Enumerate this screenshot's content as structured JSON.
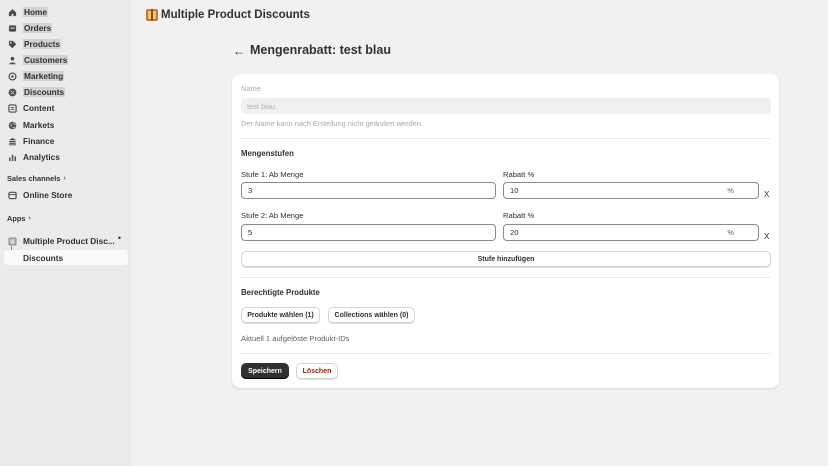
{
  "sidebar": {
    "items": [
      {
        "label": "Home",
        "icon": "home-icon"
      },
      {
        "label": "Orders",
        "icon": "orders-icon"
      },
      {
        "label": "Products",
        "icon": "tag-icon"
      },
      {
        "label": "Customers",
        "icon": "person-icon"
      },
      {
        "label": "Marketing",
        "icon": "target-icon"
      },
      {
        "label": "Discounts",
        "icon": "discount-icon"
      },
      {
        "label": "Content",
        "icon": "content-icon"
      },
      {
        "label": "Markets",
        "icon": "globe-icon"
      },
      {
        "label": "Finance",
        "icon": "bank-icon"
      },
      {
        "label": "Analytics",
        "icon": "bar-chart-icon"
      }
    ],
    "sales_channels_label": "Sales channels",
    "online_store_label": "Online Store",
    "apps_label": "Apps",
    "app_label": "Multiple Product Disc...",
    "app_subitem_label": "Discounts"
  },
  "header": {
    "app_title": "Multiple Product Discounts"
  },
  "page": {
    "back_arrow": "←",
    "title": "Mengenrabatt: test blau"
  },
  "form": {
    "name_label": "Name",
    "name_value": "test blau",
    "name_help": "Der Name kann nach Erstellung nicht geändert werden.",
    "tiers_heading": "Mengenstufen",
    "tiers": [
      {
        "qty_label": "Stufe 1: Ab Menge",
        "qty_value": "3",
        "discount_label": "Rabatt %",
        "discount_value": "10",
        "suffix": "%",
        "remove": "X"
      },
      {
        "qty_label": "Stufe 2: Ab Menge",
        "qty_value": "5",
        "discount_label": "Rabatt %",
        "discount_value": "20",
        "suffix": "%",
        "remove": "X"
      }
    ],
    "add_tier_label": "Stufe hinzufügen",
    "products_heading": "Berechtigte Produkte",
    "choose_products_label": "Produkte wählen (1)",
    "choose_collections_label": "Collections wählen (0)",
    "resolved_info": "Aktuell 1 aufgelöste Produkt-IDs",
    "save_label": "Speichern",
    "delete_label": "Löschen"
  },
  "colors": {
    "primary_button": "#303030",
    "danger_text": "#8e1f0b",
    "sidebar_bg": "#ebebeb",
    "page_bg": "#f1f1f1"
  }
}
